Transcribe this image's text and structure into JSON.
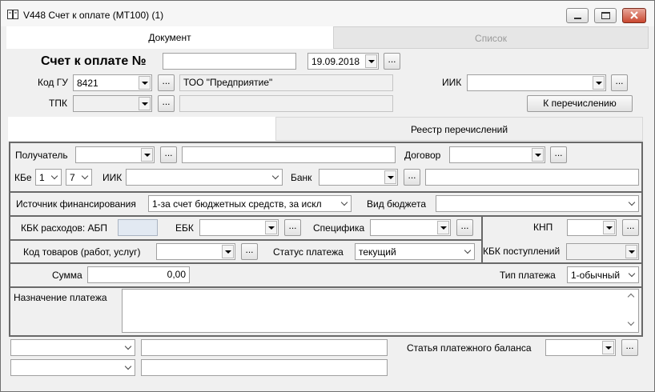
{
  "window": {
    "title": "V448 Счет к оплате (МТ100) (1)"
  },
  "tabs": {
    "document": "Документ",
    "list": "Список"
  },
  "header": {
    "invoice_label": "Счет к оплате №",
    "invoice_number": "",
    "date": "19.09.2018",
    "gu_label": "Код ГУ",
    "gu_code": "8421",
    "gu_name": "ТОО \"Предприятие\"",
    "tpk_label": "ТПК",
    "tpk_value": "",
    "iik_label": "ИИК",
    "iik_value": "",
    "transfer_button": "К перечислению"
  },
  "subtabs": {
    "registry": "Реестр перечислений"
  },
  "form": {
    "recipient_label": "Получатель",
    "contract_label": "Договор",
    "kbe_label": "КБе",
    "kbe_1": "1",
    "kbe_2": "7",
    "iik_label": "ИИК",
    "bank_label": "Банк",
    "source_label": "Источник финансирования",
    "source_value": "1-за счет бюджетных средств, за искл",
    "budget_type_label": "Вид бюджета",
    "kbk_abp_label": "КБК расходов: АБП",
    "ebk_label": "ЕБК",
    "specifics_label": "Специфика",
    "knp_label": "КНП",
    "goods_code_label": "Код товаров (работ, услуг)",
    "payment_status_label": "Статус платежа",
    "payment_status_value": "текущий",
    "kbk_income_label": "КБК поступлений",
    "amount_label": "Сумма",
    "amount_value": "0,00",
    "payment_type_label": "Тип платежа",
    "payment_type_value": "1-обычный",
    "purpose_label": "Назначение платежа",
    "balance_item_label": "Статья платежного баланса",
    "dots": "..."
  },
  "colors": {
    "frame": "#696969",
    "window_bg": "#f0f0f0",
    "field_bg": "#ffffff"
  }
}
